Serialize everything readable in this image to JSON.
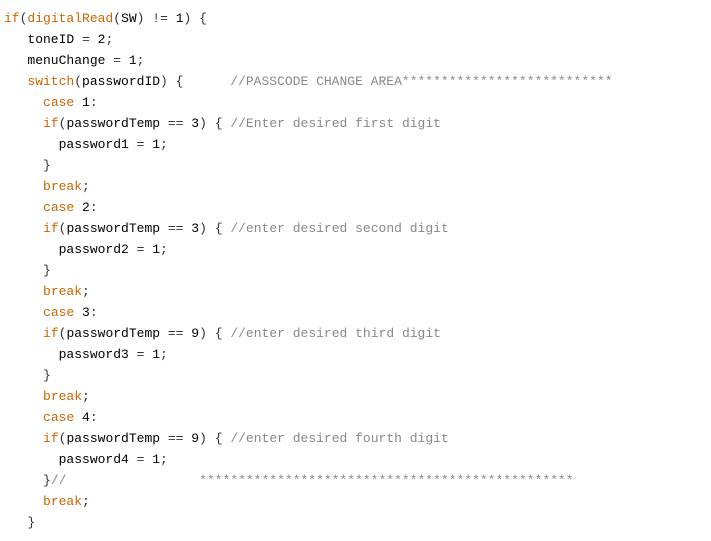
{
  "code": {
    "l1": {
      "if": "if",
      "call": "digitalRead",
      "p1": "(",
      "arg": "SW",
      "p2": ")",
      "op": " != ",
      "v": "1",
      "p3": ") {"
    },
    "l2": {
      "ws": "   ",
      "lhs": "toneID",
      "eq": " = ",
      "v": "2",
      "sc": ";"
    },
    "l3": {
      "ws": "   ",
      "lhs": "menuChange",
      "eq": " = ",
      "v": "1",
      "sc": ";"
    },
    "l4": {
      "ws": "   ",
      "sw": "switch",
      "p1": "(",
      "arg": "passwordID",
      "p2": ") {",
      "pad": "      ",
      "cmt": "//PASSCODE CHANGE AREA***************************"
    },
    "l5": {
      "ws": "     ",
      "case": "case ",
      "n": "1",
      "c": ":"
    },
    "l6": {
      "ws": "     ",
      "if": "if",
      "p1": "(",
      "lhs": "passwordTemp",
      "eq": " == ",
      "v": "3",
      "p2": ") { ",
      "cmt": "//Enter desired first digit"
    },
    "l7": {
      "ws": "       ",
      "lhs": "password1",
      "eq": " = ",
      "v": "1",
      "sc": ";"
    },
    "l8": {
      "ws": "     ",
      "close": "}"
    },
    "l9": {
      "ws": "     ",
      "break": "break",
      "sc": ";"
    },
    "l10": {
      "ws": "     ",
      "case": "case ",
      "n": "2",
      "c": ":"
    },
    "l11": {
      "ws": "     ",
      "if": "if",
      "p1": "(",
      "lhs": "passwordTemp",
      "eq": " == ",
      "v": "3",
      "p2": ") { ",
      "cmt": "//enter desired second digit"
    },
    "l12": {
      "ws": "       ",
      "lhs": "password2",
      "eq": " = ",
      "v": "1",
      "sc": ";"
    },
    "l13": {
      "ws": "     ",
      "close": "}"
    },
    "l14": {
      "ws": "     ",
      "break": "break",
      "sc": ";"
    },
    "l15": {
      "ws": "     ",
      "case": "case ",
      "n": "3",
      "c": ":"
    },
    "l16": {
      "ws": "     ",
      "if": "if",
      "p1": "(",
      "lhs": "passwordTemp",
      "eq": " == ",
      "v": "9",
      "p2": ") { ",
      "cmt": "//enter desired third digit"
    },
    "l17": {
      "ws": "       ",
      "lhs": "password3",
      "eq": " = ",
      "v": "1",
      "sc": ";"
    },
    "l18": {
      "ws": "     ",
      "close": "}"
    },
    "l19": {
      "ws": "     ",
      "break": "break",
      "sc": ";"
    },
    "l20": {
      "ws": "     ",
      "case": "case ",
      "n": "4",
      "c": ":"
    },
    "l21": {
      "ws": "     ",
      "if": "if",
      "p1": "(",
      "lhs": "passwordTemp",
      "eq": " == ",
      "v": "9",
      "p2": ") { ",
      "cmt": "//enter desired fourth digit"
    },
    "l22": {
      "ws": "       ",
      "lhs": "password4",
      "eq": " = ",
      "v": "1",
      "sc": ";"
    },
    "l23": {
      "ws": "     ",
      "close": "}",
      "slashes": "//",
      "pad": "                 ",
      "stars": "************************************************"
    },
    "l24": {
      "ws": "     ",
      "break": "break",
      "sc": ";"
    },
    "l25": {
      "ws": "   ",
      "close": "}"
    }
  }
}
